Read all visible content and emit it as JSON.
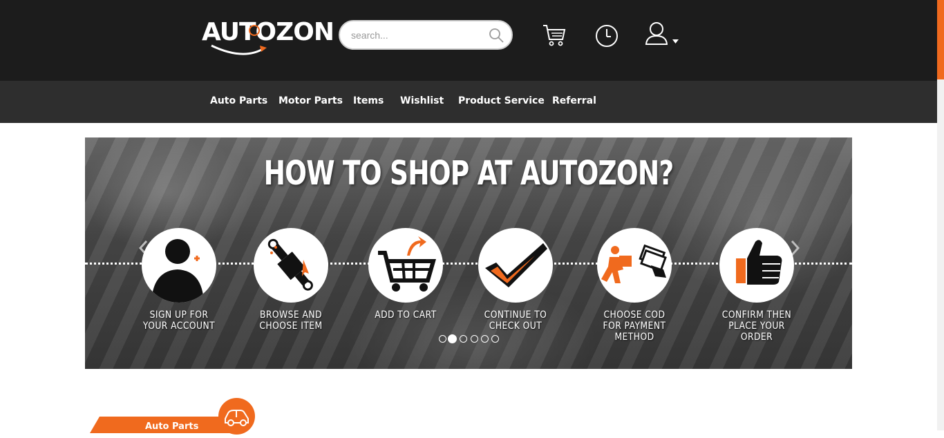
{
  "header": {
    "logo_text": "AUTOZON",
    "search_placeholder": "search...",
    "icons": [
      "search-icon",
      "cart-icon",
      "history-icon",
      "user-icon",
      "dropdown-caret-icon"
    ]
  },
  "nav": {
    "items": [
      {
        "label": "Auto Parts"
      },
      {
        "label": "Motor Parts"
      },
      {
        "label": "Items"
      },
      {
        "label": "Wishlist"
      },
      {
        "label": "Product Service"
      },
      {
        "label": "Referral"
      }
    ]
  },
  "banner": {
    "title": "HOW TO SHOP AT AUTOZON?",
    "steps": [
      {
        "line1": "SIGN UP FOR",
        "line2": "YOUR ACCOUNT",
        "line3": "",
        "icon": "user-add-icon"
      },
      {
        "line1": "BROWSE AND",
        "line2": "CHOOSE ITEM",
        "line3": "",
        "icon": "shock-absorber-icon"
      },
      {
        "line1": "ADD TO CART",
        "line2": "",
        "line3": "",
        "icon": "add-to-cart-icon"
      },
      {
        "line1": "CONTINUE TO",
        "line2": "CHECK OUT",
        "line3": "",
        "icon": "checkmark-icon"
      },
      {
        "line1": "CHOOSE COD",
        "line2": "FOR PAYMENT",
        "line3": "METHOD",
        "icon": "cash-on-delivery-icon"
      },
      {
        "line1": "CONFIRM THEN",
        "line2": "PLACE YOUR",
        "line3": "ORDER",
        "icon": "thumbs-up-icon"
      }
    ],
    "slide_count": 6,
    "active_slide": 2
  },
  "section": {
    "label": "Auto Parts",
    "icon": "car-icon"
  },
  "colors": {
    "accent": "#f06a1e",
    "header_bg": "#1c1c1c",
    "nav_bg": "#2e2e2e"
  }
}
